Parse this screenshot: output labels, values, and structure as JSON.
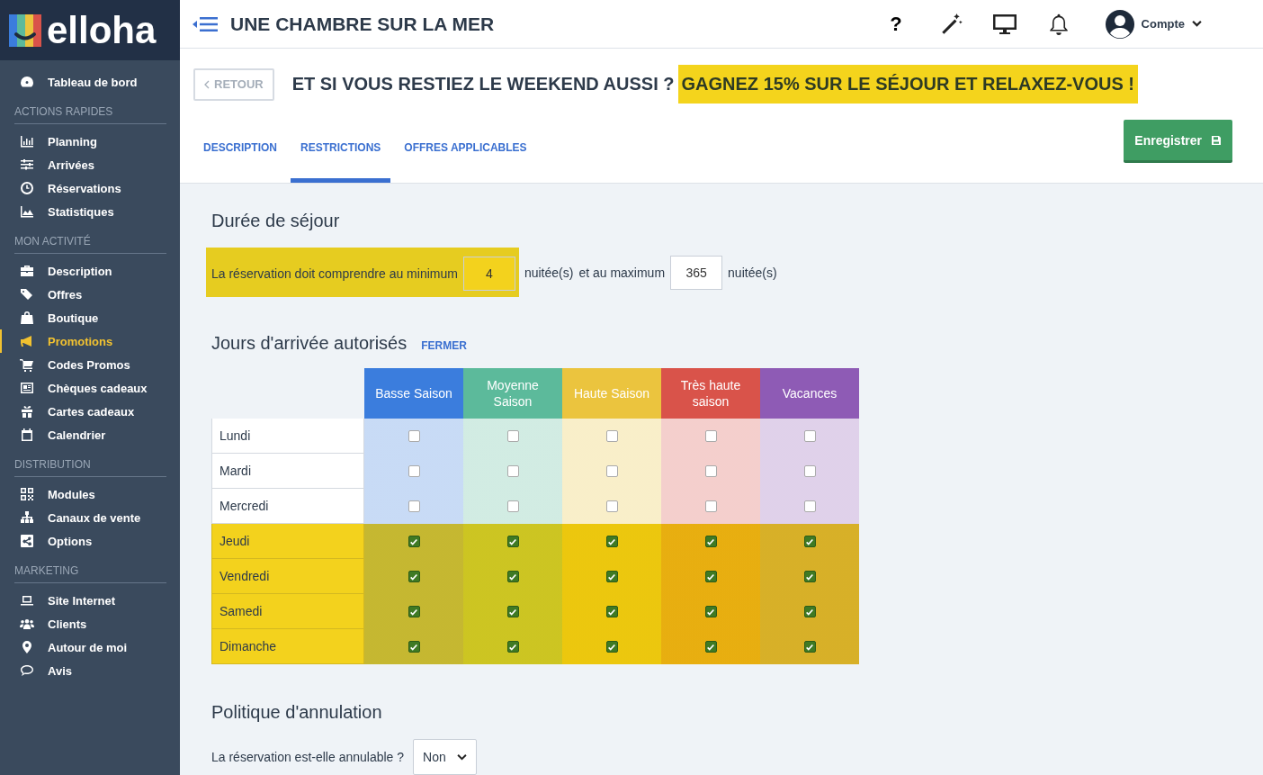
{
  "brand": {
    "name": "elloha"
  },
  "sidebar": {
    "top_item": {
      "label": "Tableau de bord",
      "selected": false
    },
    "sections": [
      {
        "title": "ACTIONS RAPIDES",
        "items": [
          {
            "label": "Planning",
            "selected": false
          },
          {
            "label": "Arrivées",
            "selected": false
          },
          {
            "label": "Réservations",
            "selected": false
          },
          {
            "label": "Statistiques",
            "selected": false
          }
        ]
      },
      {
        "title": "MON ACTIVITÉ",
        "items": [
          {
            "label": "Description",
            "selected": false
          },
          {
            "label": "Offres",
            "selected": false
          },
          {
            "label": "Boutique",
            "selected": false
          },
          {
            "label": "Promotions",
            "selected": true
          },
          {
            "label": "Codes Promos",
            "selected": false
          },
          {
            "label": "Chèques cadeaux",
            "selected": false
          },
          {
            "label": "Cartes cadeaux",
            "selected": false
          },
          {
            "label": "Calendrier",
            "selected": false
          }
        ]
      },
      {
        "title": "DISTRIBUTION",
        "items": [
          {
            "label": "Modules",
            "selected": false
          },
          {
            "label": "Canaux de vente",
            "selected": false
          },
          {
            "label": "Options",
            "selected": false
          }
        ]
      },
      {
        "title": "MARKETING",
        "items": [
          {
            "label": "Site Internet",
            "selected": false
          },
          {
            "label": "Clients",
            "selected": false
          },
          {
            "label": "Autour de moi",
            "selected": false
          },
          {
            "label": "Avis",
            "selected": false
          }
        ]
      }
    ]
  },
  "header": {
    "title": "UNE CHAMBRE SUR LA MER",
    "help": "?",
    "account": "Compte"
  },
  "promotion": {
    "back": "RETOUR",
    "title": "ET SI VOUS RESTIEZ LE WEEKEND AUSSI ?",
    "title_highlight": "GAGNEZ 15% SUR LE SÉJOUR ET RELAXEZ-VOUS !",
    "save": "Enregistrer"
  },
  "tabs": [
    {
      "label": "DESCRIPTION",
      "selected": false
    },
    {
      "label": "RESTRICTIONS",
      "selected": true
    },
    {
      "label": "OFFRES APPLICABLES",
      "selected": false
    }
  ],
  "stay": {
    "title": "Durée de séjour",
    "min_label": "La réservation doit comprendre au minimum",
    "min_value": "4",
    "min_highlighted": true,
    "unit_1": "nuitée(s)",
    "max_label": "et au maximum",
    "max_value": "365",
    "unit_2": "nuitée(s)"
  },
  "arrival": {
    "title": "Jours d'arrivée autorisés",
    "close": "FERMER",
    "seasons": [
      {
        "label": "Basse Saison",
        "color": "#3b7ddd"
      },
      {
        "label": "Moyenne Saison",
        "color": "#5cba9b"
      },
      {
        "label": "Haute Saison",
        "color": "#ebc43e"
      },
      {
        "label": "Très haute saison",
        "color": "#d9534a"
      },
      {
        "label": "Vacances",
        "color": "#8e5bb5"
      }
    ],
    "rows": [
      {
        "day": "Lundi",
        "highlighted": false,
        "checked": [
          false,
          false,
          false,
          false,
          false
        ]
      },
      {
        "day": "Mardi",
        "highlighted": false,
        "checked": [
          false,
          false,
          false,
          false,
          false
        ]
      },
      {
        "day": "Mercredi",
        "highlighted": false,
        "checked": [
          false,
          false,
          false,
          false,
          false
        ]
      },
      {
        "day": "Jeudi",
        "highlighted": true,
        "checked": [
          true,
          true,
          true,
          true,
          true
        ]
      },
      {
        "day": "Vendredi",
        "highlighted": true,
        "checked": [
          true,
          true,
          true,
          true,
          true
        ]
      },
      {
        "day": "Samedi",
        "highlighted": true,
        "checked": [
          true,
          true,
          true,
          true,
          true
        ]
      },
      {
        "day": "Dimanche",
        "highlighted": true,
        "checked": [
          true,
          true,
          true,
          true,
          true
        ]
      }
    ]
  },
  "cancellation": {
    "title": "Politique d'annulation",
    "question": "La réservation est-elle annulable ?",
    "value": "Non"
  }
}
